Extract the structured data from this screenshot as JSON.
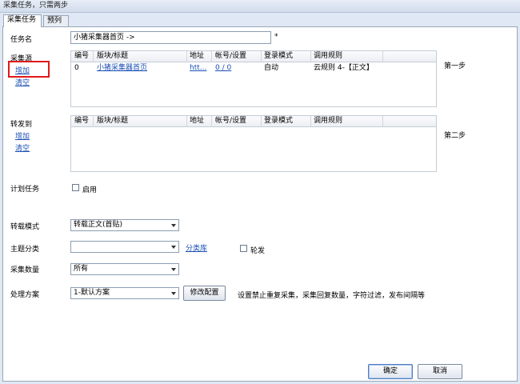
{
  "window": {
    "title": "采集任务，只需两步"
  },
  "tabs": [
    {
      "label": "采集任务",
      "active": true
    },
    {
      "label": "预列表",
      "active": false
    }
  ],
  "task_name": {
    "label": "任务名",
    "value": "小猪采集器首页 ->",
    "required_mark": "*"
  },
  "source": {
    "label": "采集源",
    "add": "增加",
    "clear": "清空",
    "step": "第一步",
    "columns": [
      "编号",
      "版块/标题",
      "地址",
      "帐号/设置",
      "登录模式",
      "调用规则"
    ],
    "rows": [
      {
        "id": "0",
        "title": "小猪采集器首页",
        "url": "htt...",
        "account": "0 / 0",
        "login": "自动",
        "rule": "云规则 4-【正文】"
      }
    ]
  },
  "forward": {
    "label": "转发到",
    "add": "增加",
    "clear": "清空",
    "step": "第二步",
    "columns": [
      "编号",
      "版块/标题",
      "地址",
      "帐号/设置",
      "登录模式",
      "调用规则"
    ]
  },
  "schedule": {
    "label": "计划任务",
    "checkbox_label": "启用",
    "checked": false
  },
  "repost_mode": {
    "label": "转载模式",
    "value": "转载正文(首贴)"
  },
  "topic": {
    "label": "主题分类",
    "value": "",
    "link": "分类库",
    "checkbox_label": "轮发",
    "checked": false
  },
  "count": {
    "label": "采集数量",
    "value": "所有"
  },
  "plan": {
    "label": "处理方案",
    "value": "1-默认方案",
    "modify_button": "修改配置",
    "description": "设置禁止重复采集，采集回复数量，字符过滤，发布间隔等"
  },
  "footer": {
    "ok": "确定",
    "cancel": "取消"
  },
  "colors": {
    "link": "#1b4fb5",
    "highlight": "#e01a1a",
    "background": "#dfe8f4"
  }
}
